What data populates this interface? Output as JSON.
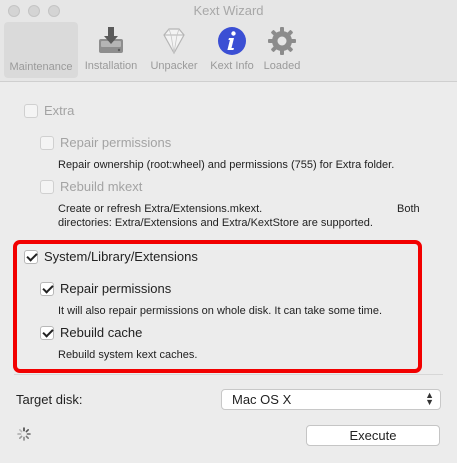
{
  "window": {
    "title": "Kext Wizard"
  },
  "toolbar": {
    "items": [
      {
        "label": "Maintenance",
        "icon": "wrench-icon"
      },
      {
        "label": "Installation",
        "icon": "disk-install-icon"
      },
      {
        "label": "Unpacker",
        "icon": "diamond-icon"
      },
      {
        "label": "Kext Info",
        "icon": "info-icon"
      },
      {
        "label": "Loaded",
        "icon": "gear-icon"
      }
    ]
  },
  "maintenance": {
    "extra": {
      "label": "Extra",
      "checked": false,
      "enabled": false
    },
    "extra_repair": {
      "label": "Repair permissions",
      "checked": false,
      "enabled": false,
      "description": "Repair ownership (root:wheel) and permissions (755) for Extra folder."
    },
    "extra_rebuild": {
      "label": "Rebuild mkext",
      "checked": false,
      "enabled": false,
      "description_line1": "Create or refresh Extra/Extensions.mkext.",
      "description_line1_right": "Both",
      "description_line2": "directories: Extra/Extensions and Extra/KextStore are supported."
    },
    "system": {
      "label": "System/Library/Extensions",
      "checked": true,
      "enabled": true
    },
    "system_repair": {
      "label": "Repair permissions",
      "checked": true,
      "enabled": true,
      "description": "It will also repair permissions on whole disk. It can take some time."
    },
    "system_rebuild": {
      "label": "Rebuild cache",
      "checked": true,
      "enabled": true,
      "description": "Rebuild system kext caches."
    }
  },
  "target": {
    "label": "Target disk:",
    "value": "Mac OS X"
  },
  "execute": {
    "label": "Execute"
  },
  "colors": {
    "highlight": "#f20000",
    "info_icon": "#3b4fd4"
  }
}
